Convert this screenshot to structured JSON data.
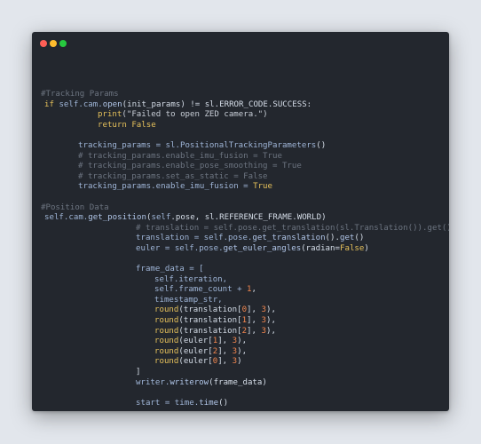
{
  "window": {
    "controls": [
      {
        "name": "close-button",
        "color": "#ff5f56"
      },
      {
        "name": "minimize-button",
        "color": "#ffbd2e"
      },
      {
        "name": "maximize-button",
        "color": "#27c93f"
      }
    ]
  },
  "colors": {
    "comment": "#6c7480",
    "keyword": "#e6c15b",
    "default": "#d5dde8",
    "attr": "#9fb5d7",
    "string": "#c9cfd8",
    "number": "#f3874f",
    "bracket": "#f3874f",
    "func": "#b1c6e8"
  },
  "code": [
    {
      "indent": 10,
      "tokens": [
        {
          "t": "#Tracking Params",
          "c": "comment"
        }
      ]
    },
    {
      "indent": 14,
      "tokens": [
        {
          "t": "if ",
          "c": "keyword"
        },
        {
          "t": "self",
          "c": "attr"
        },
        {
          "t": ".cam.",
          "c": "attr"
        },
        {
          "t": "open",
          "c": "func"
        },
        {
          "t": "(init_params) != sl.ERROR_CODE.SUCCESS:",
          "c": "default"
        }
      ]
    },
    {
      "indent": 74,
      "tokens": [
        {
          "t": "print",
          "c": "keyword"
        },
        {
          "t": "(\"Failed to open ZED camera.\")",
          "c": "string"
        }
      ]
    },
    {
      "indent": 74,
      "tokens": [
        {
          "t": "return ",
          "c": "keyword"
        },
        {
          "t": "False",
          "c": "keyword"
        }
      ]
    },
    {
      "gap": true
    },
    {
      "indent": 52,
      "tokens": [
        {
          "t": "tracking_params = sl.",
          "c": "attr"
        },
        {
          "t": "PositionalTrackingParameters",
          "c": "attr"
        },
        {
          "t": "()",
          "c": "default"
        }
      ]
    },
    {
      "indent": 52,
      "tokens": [
        {
          "t": "# tracking_params.enable_imu_fusion = True",
          "c": "comment"
        }
      ]
    },
    {
      "indent": 52,
      "tokens": [
        {
          "t": "# tracking_params.enable_pose_smoothing = True",
          "c": "comment"
        }
      ]
    },
    {
      "indent": 52,
      "tokens": [
        {
          "t": "# tracking_params.set_as_static = False",
          "c": "comment"
        }
      ]
    },
    {
      "indent": 52,
      "tokens": [
        {
          "t": "tracking_params.enable_imu_fusion = ",
          "c": "attr"
        },
        {
          "t": "True",
          "c": "keyword"
        }
      ]
    },
    {
      "gap": true
    },
    {
      "indent": 10,
      "tokens": [
        {
          "t": "#Position Data",
          "c": "comment"
        }
      ]
    },
    {
      "indent": 14,
      "tokens": [
        {
          "t": "self",
          "c": "attr"
        },
        {
          "t": ".cam.",
          "c": "attr"
        },
        {
          "t": "get_position",
          "c": "func"
        },
        {
          "t": "(",
          "c": "default"
        },
        {
          "t": "self",
          "c": "attr"
        },
        {
          "t": ".pose, sl.REFERENCE_FRAME.WORLD)",
          "c": "default"
        }
      ]
    },
    {
      "indent": 117,
      "tokens": [
        {
          "t": "# translation = self.pose.get_translation(sl.Translation()).get()",
          "c": "comment"
        }
      ]
    },
    {
      "indent": 117,
      "tokens": [
        {
          "t": "translation = ",
          "c": "attr"
        },
        {
          "t": "self",
          "c": "attr"
        },
        {
          "t": ".pose.",
          "c": "attr"
        },
        {
          "t": "get_translation",
          "c": "func"
        },
        {
          "t": "().",
          "c": "default"
        },
        {
          "t": "get",
          "c": "func"
        },
        {
          "t": "()",
          "c": "default"
        }
      ]
    },
    {
      "indent": 117,
      "tokens": [
        {
          "t": "euler = ",
          "c": "attr"
        },
        {
          "t": "self",
          "c": "attr"
        },
        {
          "t": ".pose.",
          "c": "attr"
        },
        {
          "t": "get_euler_angles",
          "c": "func"
        },
        {
          "t": "(radian=",
          "c": "default"
        },
        {
          "t": "False",
          "c": "keyword"
        },
        {
          "t": ")",
          "c": "default"
        }
      ]
    },
    {
      "gap": true
    },
    {
      "indent": 117,
      "tokens": [
        {
          "t": "frame_data = [",
          "c": "attr"
        }
      ]
    },
    {
      "indent": 138,
      "tokens": [
        {
          "t": "self",
          "c": "attr"
        },
        {
          "t": ".iteration,",
          "c": "attr"
        }
      ]
    },
    {
      "indent": 138,
      "tokens": [
        {
          "t": "self",
          "c": "attr"
        },
        {
          "t": ".frame_count + ",
          "c": "attr"
        },
        {
          "t": "1",
          "c": "number"
        },
        {
          "t": ",",
          "c": "default"
        }
      ]
    },
    {
      "indent": 138,
      "tokens": [
        {
          "t": "timestamp_str,",
          "c": "attr"
        }
      ]
    },
    {
      "indent": 138,
      "tokens": [
        {
          "t": "round",
          "c": "keyword"
        },
        {
          "t": "(translation[",
          "c": "default"
        },
        {
          "t": "0",
          "c": "number"
        },
        {
          "t": "], ",
          "c": "default"
        },
        {
          "t": "3",
          "c": "number"
        },
        {
          "t": "),",
          "c": "default"
        }
      ]
    },
    {
      "indent": 138,
      "tokens": [
        {
          "t": "round",
          "c": "keyword"
        },
        {
          "t": "(translation[",
          "c": "default"
        },
        {
          "t": "1",
          "c": "number"
        },
        {
          "t": "], ",
          "c": "default"
        },
        {
          "t": "3",
          "c": "number"
        },
        {
          "t": "),",
          "c": "default"
        }
      ]
    },
    {
      "indent": 138,
      "tokens": [
        {
          "t": "round",
          "c": "keyword"
        },
        {
          "t": "(translation[",
          "c": "default"
        },
        {
          "t": "2",
          "c": "number"
        },
        {
          "t": "], ",
          "c": "default"
        },
        {
          "t": "3",
          "c": "number"
        },
        {
          "t": "),",
          "c": "default"
        }
      ]
    },
    {
      "indent": 138,
      "tokens": [
        {
          "t": "round",
          "c": "keyword"
        },
        {
          "t": "(euler[",
          "c": "default"
        },
        {
          "t": "1",
          "c": "number"
        },
        {
          "t": "], ",
          "c": "default"
        },
        {
          "t": "3",
          "c": "number"
        },
        {
          "t": "),",
          "c": "default"
        }
      ]
    },
    {
      "indent": 138,
      "tokens": [
        {
          "t": "round",
          "c": "keyword"
        },
        {
          "t": "(euler[",
          "c": "default"
        },
        {
          "t": "2",
          "c": "number"
        },
        {
          "t": "], ",
          "c": "default"
        },
        {
          "t": "3",
          "c": "number"
        },
        {
          "t": "),",
          "c": "default"
        }
      ]
    },
    {
      "indent": 138,
      "tokens": [
        {
          "t": "round",
          "c": "keyword"
        },
        {
          "t": "(euler[",
          "c": "default"
        },
        {
          "t": "0",
          "c": "number"
        },
        {
          "t": "], ",
          "c": "default"
        },
        {
          "t": "3",
          "c": "number"
        },
        {
          "t": ")",
          "c": "default"
        }
      ]
    },
    {
      "indent": 117,
      "tokens": [
        {
          "t": "]",
          "c": "default"
        }
      ]
    },
    {
      "indent": 117,
      "tokens": [
        {
          "t": "writer.",
          "c": "attr"
        },
        {
          "t": "writerow",
          "c": "func"
        },
        {
          "t": "(frame_data)",
          "c": "default"
        }
      ]
    },
    {
      "gap": true
    },
    {
      "indent": 117,
      "tokens": [
        {
          "t": "start = time.",
          "c": "attr"
        },
        {
          "t": "time",
          "c": "func"
        },
        {
          "t": "()",
          "c": "default"
        }
      ]
    }
  ]
}
